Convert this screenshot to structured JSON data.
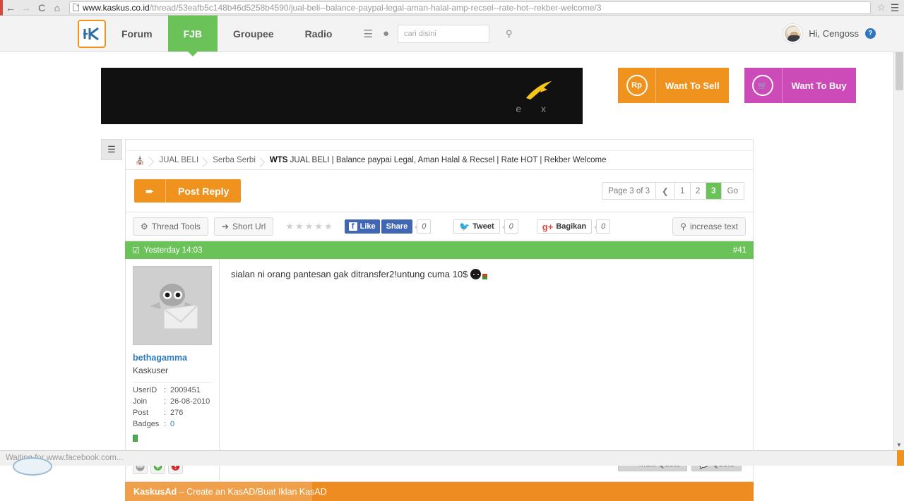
{
  "browser": {
    "back_icon": "back-arrow-icon",
    "forward_icon": "forward-arrow-icon",
    "reload_icon": "reload-icon",
    "home_icon": "home-icon",
    "url_domain": "www.kaskus.co.id",
    "url_path": "/thread/53eafb5c148b46d5258b4590/jual-beli--balance-paypal-legal-aman-halal-amp-recsel--rate-hot--rekber-welcome/3",
    "bookmark_icon": "star-icon",
    "menu_icon": "hamburger-menu-icon",
    "status_text": "Waiting for www.facebook.com..."
  },
  "header": {
    "logo": "kaskus-logo",
    "nav": [
      {
        "label": "Forum",
        "active": false
      },
      {
        "label": "FJB",
        "active": true
      },
      {
        "label": "Groupee",
        "active": false
      },
      {
        "label": "Radio",
        "active": false
      }
    ],
    "icons": [
      "list-icon",
      "location-pin-icon"
    ],
    "search": {
      "placeholder": "cari disini",
      "value": "",
      "icon": "search-icon"
    },
    "user": {
      "greeting": "Hi, Cengoss",
      "avatar": "user-avatar",
      "help_badge": "?"
    }
  },
  "banner": {
    "ad_logo_mark": "yellow-swoosh-logo",
    "ad_letters": "e x",
    "want_to_sell": {
      "label": "Want To Sell",
      "icon_text": "Rp",
      "color": "#f0931e"
    },
    "want_to_buy": {
      "label": "Want To Buy",
      "icon": "shopping-cart-icon",
      "color": "#cc4bb8"
    }
  },
  "sidebar_toggle_icon": "list-toggle-icon",
  "breadcrumb": {
    "home_icon": "home-icon",
    "items": [
      "JUAL BELI",
      "Serba Serbi"
    ],
    "current_prefix": "WTS",
    "current": "JUAL BELI | Balance paypai Legal, Aman Halal & Recsel | Rate HOT | Rekber Welcome"
  },
  "reply_bar": {
    "post_reply_label": "Post Reply",
    "post_reply_icon": "reply-arrow-icon",
    "pagination": {
      "page_label": "Page 3 of 3",
      "prev_icon": "chevron-left-icon",
      "pages": [
        "1",
        "2",
        "3"
      ],
      "active_page": "3",
      "go_label": "Go"
    }
  },
  "tools_bar": {
    "thread_tools": {
      "label": "Thread Tools",
      "icon": "gear-icon"
    },
    "short_url": {
      "label": "Short Url",
      "icon": "share-icon"
    },
    "rating_stars": 5,
    "rating_filled": 0,
    "facebook": {
      "like_label": "Like",
      "share_label": "Share",
      "count": "0",
      "f_glyph": "f"
    },
    "twitter": {
      "label": "Tweet",
      "count": "0",
      "icon": "twitter-bird-icon"
    },
    "google_plus": {
      "label": "Bagikan",
      "count": "0",
      "glyph": "g+"
    },
    "increase_text": {
      "label": "increase text",
      "icon": "zoom-in-icon"
    }
  },
  "post": {
    "header": {
      "check_icon": "checkbox-checked-icon",
      "timestamp": "Yesterday 14:03",
      "number": "#41"
    },
    "author": {
      "avatar": "default-avatar-placeholder",
      "name": "bethagamma",
      "title": "Kaskuser",
      "stats": [
        {
          "key": "UserID",
          "value": "2009451",
          "link": false
        },
        {
          "key": "Join",
          "value": "26-08-2010",
          "link": false
        },
        {
          "key": "Post",
          "value": "276",
          "link": false
        },
        {
          "key": "Badges",
          "value": "0",
          "link": true
        }
      ],
      "online_status": "online",
      "actions": [
        "pm-icon",
        "grp-plus-icon",
        "brp-minus-icon"
      ]
    },
    "content": "sialan ni orang pantesan gak ditransfer2!untung cuma 10$",
    "content_emoticon": "shocked-face-emoticon",
    "footer": {
      "multi_quote": {
        "label": "Multi Quote",
        "icon": "multi-comment-icon"
      },
      "quote": {
        "label": "Quote",
        "icon": "comment-icon"
      }
    }
  },
  "kaskus_ad": {
    "brand": "KaskusAd",
    "dash": "–",
    "text": "Create an KasAD/Buat Iklan KasAD"
  },
  "colors": {
    "kaskus_green": "#6ac259",
    "kaskus_orange": "#f0931e",
    "buy_magenta": "#cc4bb8",
    "link_blue": "#2e7bbf"
  }
}
